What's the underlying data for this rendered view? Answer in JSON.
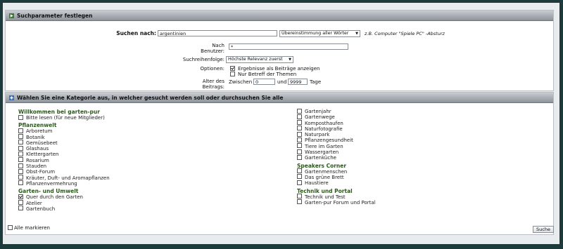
{
  "search_params": {
    "title": "Suchparameter festlegen",
    "search_label": "Suchen nach:",
    "search_value": "argentinien",
    "match_select": "Übereinstimmung aller Wörter",
    "example": "z.B. Computer \"Spiele PC\" -Absturz",
    "author_label_line1": "Nach",
    "author_label_line2": "Benutzer:",
    "author_value": "*",
    "order_label": "Suchreihenfolge:",
    "order_select": "Höchste Relevanz zuerst",
    "options_label": "Optionen:",
    "option_show_posts": "Ergebnisse als Beiträge anzeigen",
    "option_subject_only": "Nur Betreff der Themen",
    "age_label_line1": "Alter des",
    "age_label_line2": "Beitrags:",
    "between_label": "Zwischen",
    "age_from": "0",
    "and_label": "und",
    "age_to": "9999",
    "days_label": "Tage"
  },
  "categories": {
    "title": "Wählen Sie eine Kategorie aus, in welcher gesucht werden soll oder durchsuchen Sie alle",
    "left": {
      "g1_title": "Willkommen bei garten-pur",
      "g1_items": [
        "Bitte lesen (für neue Mitglieder)"
      ],
      "g2_title": "Pflanzenwelt",
      "g2_items": [
        "Arboretum",
        "Botanik",
        "Gemüsebeet",
        "Glashaus",
        "Klettergarten",
        "Rosarium",
        "Stauden",
        "Obst-Forum",
        "Kräuter, Duft- und Aromapflanzen",
        "Pflanzenvermehrung"
      ],
      "g3_title": "Garten- und Umwelt",
      "g3_items": [
        "Quer durch den Garten",
        "Atelier",
        "Gartenbuch"
      ]
    },
    "right": {
      "g0_items": [
        "Gartenjahr",
        "Gartenwege",
        "Komposthaufen",
        "Naturfotografie",
        "Naturpark",
        "Pflanzengesundheit",
        "Tiere im Garten",
        "Wassergarten",
        "Gartenküche"
      ],
      "g1_title": "Speakers Corner",
      "g1_items": [
        "Gartenmenschen",
        "Das grüne Brett",
        "Haustiere"
      ],
      "g2_title": "Technik und Portal",
      "g2_items": [
        "Technik und Test",
        "Garten-pur Forum und Portal"
      ]
    },
    "mark_all": "Alle markieren",
    "search_button": "Suche"
  },
  "colors": {
    "background": "#1d3b3a",
    "group_title": "#2a5a1a"
  }
}
